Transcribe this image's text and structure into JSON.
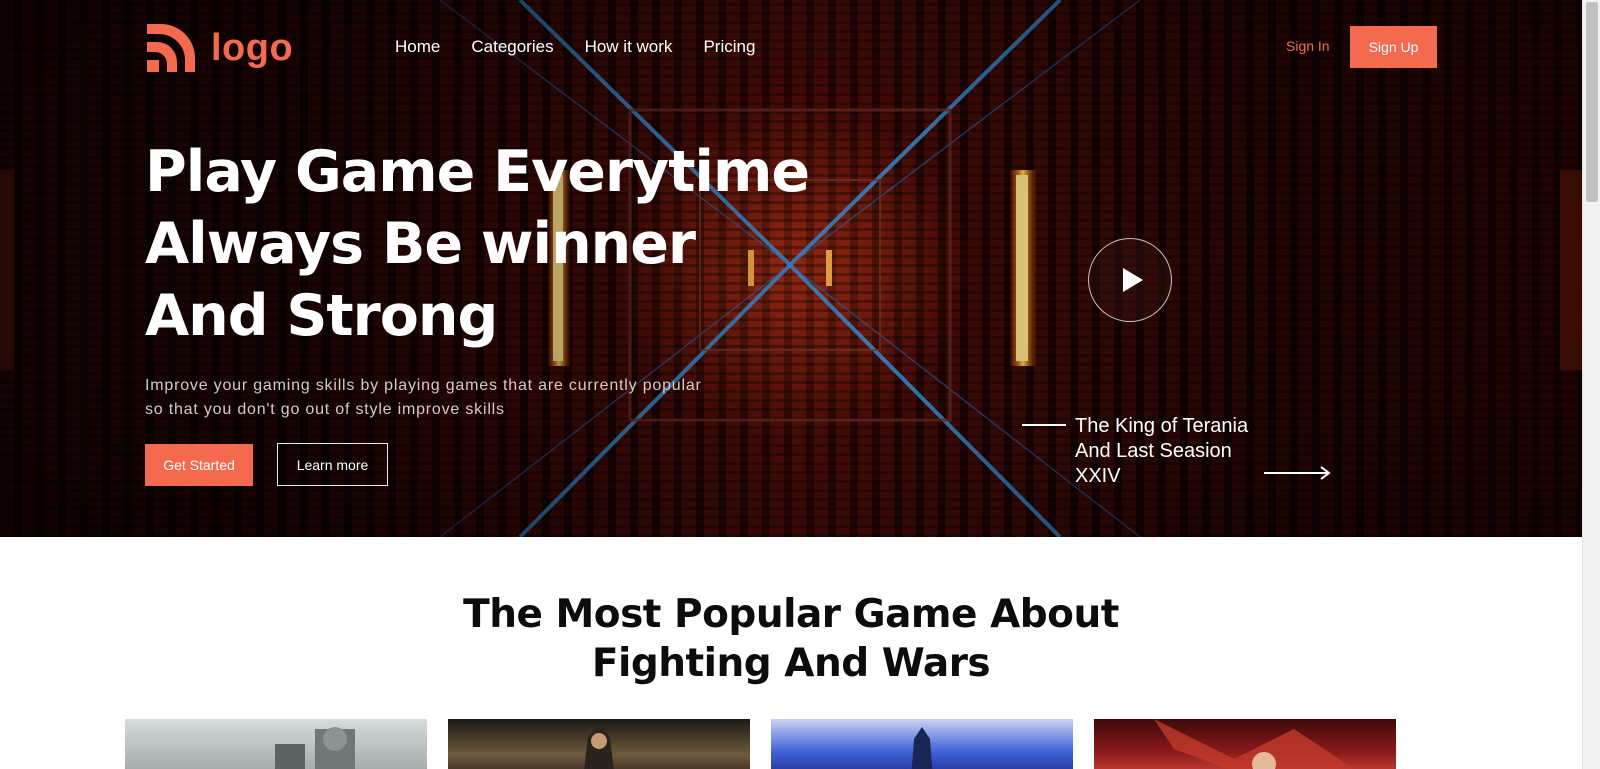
{
  "brand": {
    "logo_text": "logo",
    "accent_color": "#f46a4e"
  },
  "nav": {
    "items": [
      {
        "label": "Home"
      },
      {
        "label": "Categories"
      },
      {
        "label": "How it work"
      },
      {
        "label": "Pricing"
      }
    ],
    "sign_in": "Sign In",
    "sign_up": "Sign Up"
  },
  "hero": {
    "headline_lines": [
      "Play Game Everytime",
      "Always Be winner",
      "And Strong"
    ],
    "subtext": "Improve your gaming skills by playing games that are currently popular so that you don't go out of style improve skills",
    "primary_button": "Get Started",
    "secondary_button": "Learn more",
    "play_icon": "play-icon",
    "season_lines": [
      "The King of Terania",
      "And Last Seasion",
      "XXIV"
    ],
    "season_arrow_icon": "arrow-right-icon"
  },
  "section": {
    "title_lines": [
      "The Most Popular Game About",
      "Fighting And Wars"
    ],
    "cards": [
      {
        "theme": "snow-soldiers"
      },
      {
        "theme": "hooded-archer"
      },
      {
        "theme": "blue-warrior"
      },
      {
        "theme": "red-creature"
      }
    ]
  }
}
